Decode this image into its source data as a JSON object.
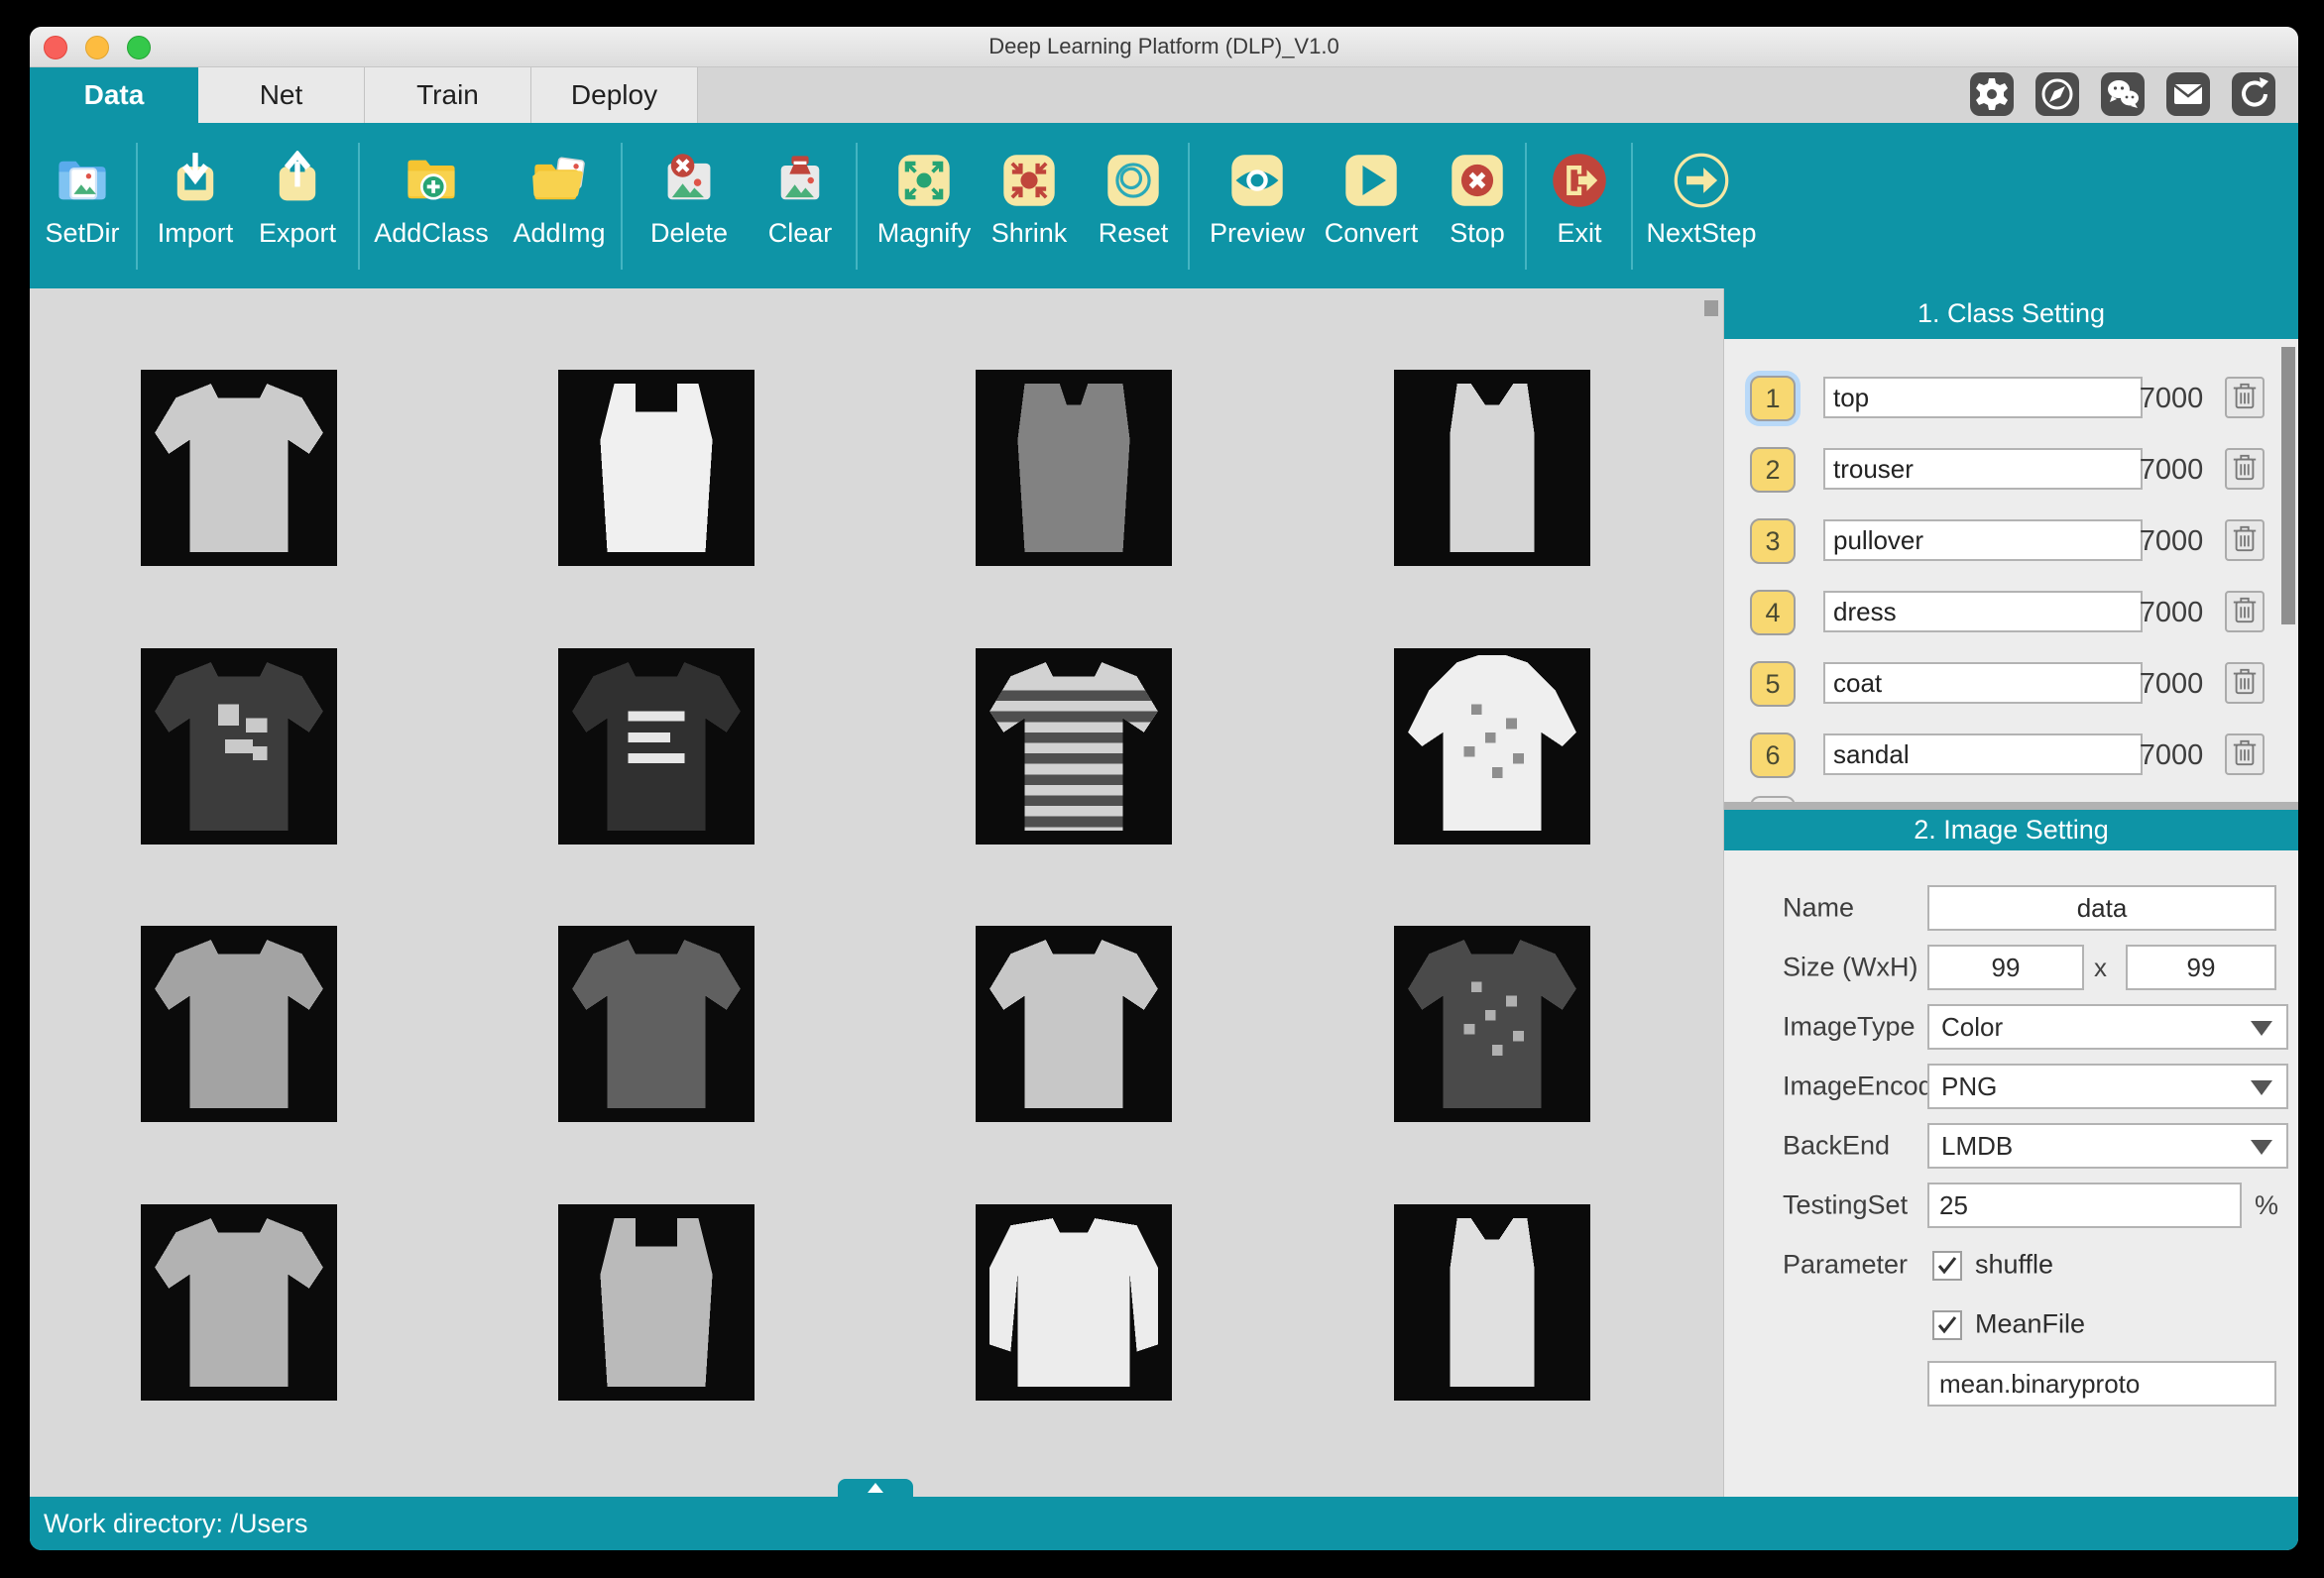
{
  "window": {
    "title": "Deep Learning Platform (DLP)_V1.0"
  },
  "traffic_lights": [
    "close",
    "minimize",
    "zoom"
  ],
  "tabs": [
    {
      "label": "Data",
      "active": true
    },
    {
      "label": "Net",
      "active": false
    },
    {
      "label": "Train",
      "active": false
    },
    {
      "label": "Deploy",
      "active": false
    }
  ],
  "titlebar_icons": [
    "gear-icon",
    "compass-icon",
    "wechat-icon",
    "mail-icon",
    "sync-icon"
  ],
  "toolbar": {
    "buttons": [
      {
        "label": "SetDir",
        "icon": "folder-image-icon",
        "group_end": true
      },
      {
        "label": "Import",
        "icon": "import-icon",
        "group_end": false
      },
      {
        "label": "Export",
        "icon": "export-icon",
        "group_end": true
      },
      {
        "label": "AddClass",
        "icon": "folder-plus-icon",
        "group_end": false
      },
      {
        "label": "AddImg",
        "icon": "folder-photo-icon",
        "group_end": true
      },
      {
        "label": "Delete",
        "icon": "photo-delete-icon",
        "group_end": false
      },
      {
        "label": "Clear",
        "icon": "photo-clear-icon",
        "group_end": true
      },
      {
        "label": "Magnify",
        "icon": "magnify-icon",
        "group_end": false
      },
      {
        "label": "Shrink",
        "icon": "shrink-icon",
        "group_end": false
      },
      {
        "label": "Reset",
        "icon": "reset-icon",
        "group_end": true
      },
      {
        "label": "Preview",
        "icon": "preview-eye-icon",
        "group_end": false
      },
      {
        "label": "Convert",
        "icon": "convert-play-icon",
        "group_end": false
      },
      {
        "label": "Stop",
        "icon": "stop-icon",
        "group_end": true
      },
      {
        "label": "Exit",
        "icon": "exit-icon",
        "group_end": true
      },
      {
        "label": "NextStep",
        "icon": "next-step-icon",
        "group_end": false
      }
    ]
  },
  "gallery": {
    "items": [
      {
        "garment": "t-shirt",
        "fill": "#cbcbcb"
      },
      {
        "garment": "tank-top",
        "fill": "#f0f0f0"
      },
      {
        "garment": "sleeveless-vest",
        "fill": "#828282"
      },
      {
        "garment": "camisole",
        "fill": "#d6d6d6"
      },
      {
        "garment": "t-shirt",
        "fill": "#3c3c3c",
        "print": "blocks",
        "print_color": "#c9c9c9"
      },
      {
        "garment": "t-shirt",
        "fill": "#303030",
        "print": "lines",
        "print_color": "#e6e6e6"
      },
      {
        "garment": "t-shirt",
        "fill": "#d2d2d2",
        "stripes": "#4f4f4f"
      },
      {
        "garment": "hoodie",
        "fill": "#efefef",
        "print": "speckle",
        "print_color": "#8e8e8e"
      },
      {
        "garment": "t-shirt",
        "fill": "#a3a3a3"
      },
      {
        "garment": "t-shirt",
        "fill": "#606060"
      },
      {
        "garment": "t-shirt",
        "fill": "#c7c7c7"
      },
      {
        "garment": "t-shirt",
        "fill": "#4a4a4a",
        "print": "speckle",
        "print_color": "#b0b0b0"
      },
      {
        "garment": "t-shirt",
        "fill": "#b2b2b2"
      },
      {
        "garment": "tank-top",
        "fill": "#bababa"
      },
      {
        "garment": "long-sleeve",
        "fill": "#ececec"
      },
      {
        "garment": "camisole",
        "fill": "#e0e0e0"
      }
    ]
  },
  "class_setting": {
    "title": "1. Class Setting",
    "rows": [
      {
        "index": "1",
        "name": "top",
        "count": "7000",
        "selected": true
      },
      {
        "index": "2",
        "name": "trouser",
        "count": "7000",
        "selected": false
      },
      {
        "index": "3",
        "name": "pullover",
        "count": "7000",
        "selected": false
      },
      {
        "index": "4",
        "name": "dress",
        "count": "7000",
        "selected": false
      },
      {
        "index": "5",
        "name": "coat",
        "count": "7000",
        "selected": false
      },
      {
        "index": "6",
        "name": "sandal",
        "count": "7000",
        "selected": false
      }
    ],
    "delete_icon": "trash-icon"
  },
  "image_setting": {
    "title": "2. Image Setting",
    "name_label": "Name",
    "name_value": "data",
    "size_label": "Size (WxH)",
    "size_w": "99",
    "size_sep": "x",
    "size_h": "99",
    "imagetype_label": "ImageType",
    "imagetype_value": "Color",
    "imageencode_label": "ImageEncode",
    "imageencode_value": "PNG",
    "backend_label": "BackEnd",
    "backend_value": "LMDB",
    "testingset_label": "TestingSet",
    "testingset_value": "25",
    "testingset_unit": "%",
    "parameter_label": "Parameter",
    "shuffle_label": "shuffle",
    "shuffle_checked": true,
    "meanfile_label": "MeanFile",
    "meanfile_checked": true,
    "meanfile_value": "mean.binaryproto"
  },
  "statusbar": {
    "text": "Work directory: /Users"
  },
  "colors": {
    "teal": "#0e94a6",
    "teal_light": "#44b4c2",
    "cream": "#f7e7a4",
    "red": "#c0453b",
    "green": "#27a474",
    "yellow": "#f5c431",
    "yellow_light": "#f8d24e",
    "blue": "#5aabec",
    "blue_light": "#7fc3f2",
    "photo_green": "#49b07a",
    "photo_red": "#df5449",
    "mini_icon_gray": "#4c4c4c"
  }
}
